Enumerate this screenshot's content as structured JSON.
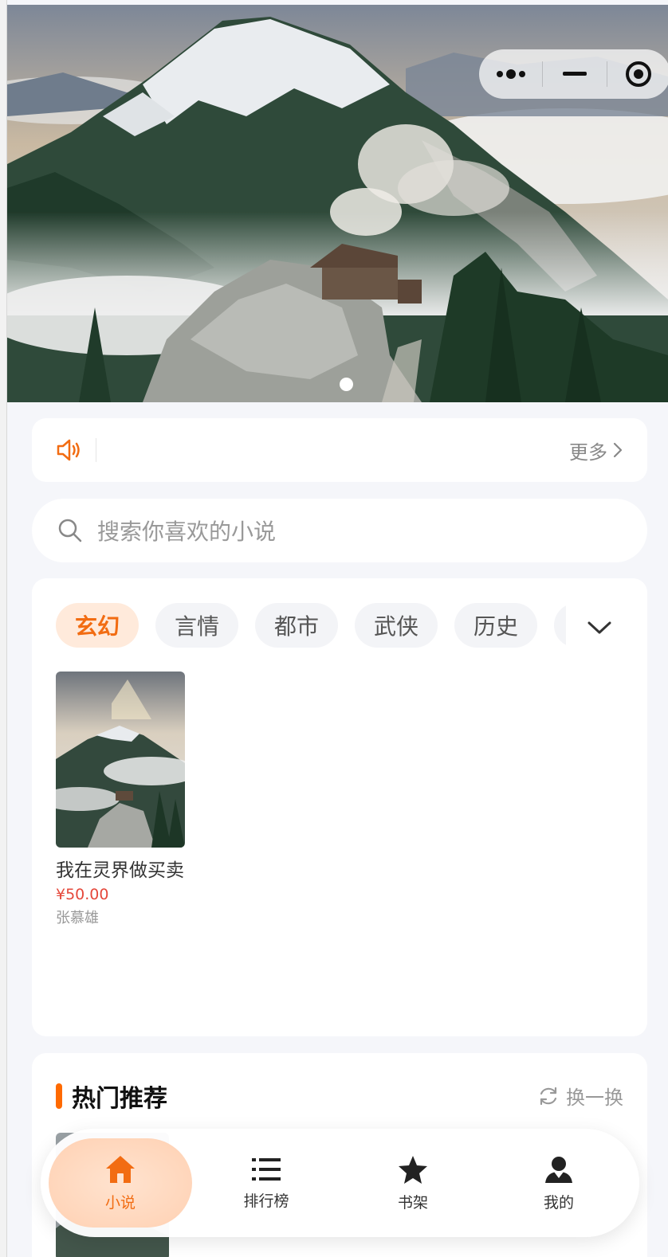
{
  "capsule": {
    "more_icon": "more-dots-icon",
    "minimize_icon": "minimize-icon",
    "close_icon": "target-circle-icon"
  },
  "banner": {
    "slides_count": 1,
    "active_index": 0
  },
  "notice": {
    "icon": "speaker-icon",
    "text": "",
    "more_label": "更多",
    "more_icon": "chevron-right-icon"
  },
  "search": {
    "placeholder": "搜索你喜欢的小说"
  },
  "categories": {
    "tabs": [
      "玄幻",
      "言情",
      "都市",
      "武侠",
      "历史",
      ""
    ],
    "active_index": 0,
    "expand_icon": "chevron-down-icon"
  },
  "books": [
    {
      "title": "我在灵界做买卖",
      "price": "¥50.00",
      "author": "张慕雄"
    }
  ],
  "hot": {
    "title": "热门推荐",
    "refresh_label": "换一换",
    "refresh_icon": "refresh-icon"
  },
  "tabbar": {
    "items": [
      {
        "label": "小说",
        "icon": "home-icon",
        "active": true
      },
      {
        "label": "排行榜",
        "icon": "list-icon",
        "active": false
      },
      {
        "label": "书架",
        "icon": "star-icon",
        "active": false
      },
      {
        "label": "我的",
        "icon": "user-icon",
        "active": false
      }
    ]
  },
  "colors": {
    "accent": "#f26c12",
    "price": "#e5483b",
    "page_bg": "#f5f6fa"
  }
}
